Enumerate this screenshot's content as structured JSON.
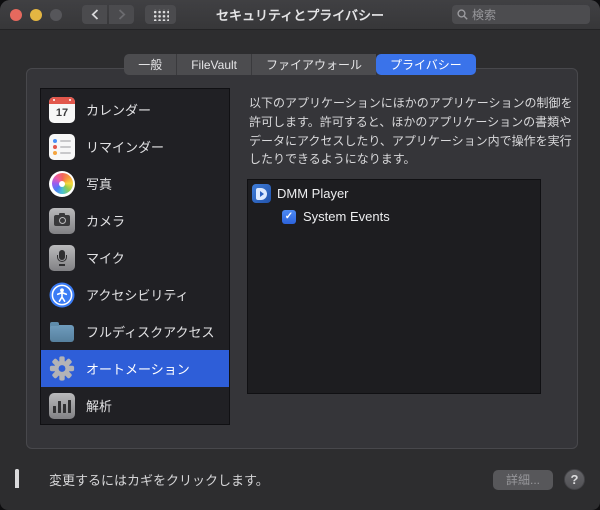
{
  "window": {
    "title": "セキュリティとプライバシー",
    "search_placeholder": "検索"
  },
  "tabs": [
    {
      "label": "一般",
      "selected": false
    },
    {
      "label": "FileVault",
      "selected": false
    },
    {
      "label": "ファイアウォール",
      "selected": false
    },
    {
      "label": "プライバシー",
      "selected": true
    }
  ],
  "sidebar": {
    "items": [
      {
        "label": "カレンダー",
        "icon": "calendar-icon",
        "selected": false
      },
      {
        "label": "リマインダー",
        "icon": "reminders-icon",
        "selected": false
      },
      {
        "label": "写真",
        "icon": "photos-icon",
        "selected": false
      },
      {
        "label": "カメラ",
        "icon": "camera-icon",
        "selected": false
      },
      {
        "label": "マイク",
        "icon": "microphone-icon",
        "selected": false
      },
      {
        "label": "アクセシビリティ",
        "icon": "accessibility-icon",
        "selected": false
      },
      {
        "label": "フルディスクアクセス",
        "icon": "folder-icon",
        "selected": false
      },
      {
        "label": "オートメーション",
        "icon": "gear-icon",
        "selected": true
      },
      {
        "label": "解析",
        "icon": "analytics-icon",
        "selected": false
      }
    ],
    "calendar_day": "17"
  },
  "content": {
    "description": "以下のアプリケーションにほかのアプリケーションの制御を許可します。許可すると、ほかのアプリケーションの書類やデータにアクセスしたり、アプリケーション内で操作を実行したりできるようになります。",
    "apps": [
      {
        "name": "DMM Player",
        "icon": "dmm-player-icon",
        "children": [
          {
            "name": "System Events",
            "checked": true
          }
        ]
      }
    ],
    "checkbox_glyph": "✓"
  },
  "footer": {
    "lock_locked": true,
    "lock_text": "変更するにはカギをクリックします。",
    "details_button": "詳細...",
    "details_enabled": false,
    "help_button": "?"
  },
  "colors": {
    "accent_tab_blue": "#3a73ea",
    "selection_blue": "#2e5ed8",
    "checkbox_blue": "#2c63dc",
    "lock_gold": "#d5a33f",
    "panel_bg": "#353539",
    "listbox_bg": "#1d1d20",
    "titlebar_bg": "#3b3b3e"
  }
}
